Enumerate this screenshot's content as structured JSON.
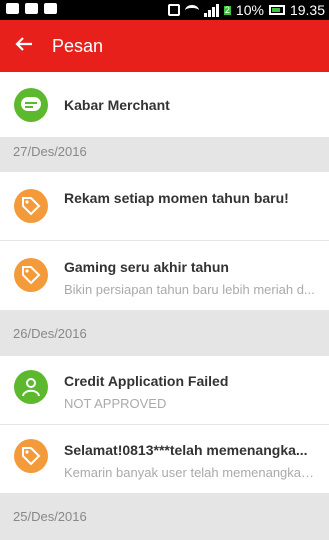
{
  "status_bar": {
    "battery": "10%",
    "time": "19.35",
    "sim_label": "2"
  },
  "app_bar": {
    "title": "Pesan"
  },
  "merchant": {
    "title": "Kabar Merchant"
  },
  "sections": [
    {
      "date": "27/Des/2016",
      "items": [
        {
          "title": "Rekam setiap momen tahun baru!",
          "subtitle": "",
          "icon": "tag-icon"
        },
        {
          "title": "Gaming seru akhir tahun",
          "subtitle": "Bikin persiapan tahun baru lebih meriah d...",
          "icon": "tag-icon"
        }
      ]
    },
    {
      "date": "26/Des/2016",
      "items": [
        {
          "title": "Credit Application Failed",
          "subtitle": "NOT APPROVED",
          "icon": "user-icon"
        },
        {
          "title": "Selamat!0813***telah memenangka...",
          "subtitle": "Kemarin banyak user telah memenangkan...",
          "icon": "tag-icon"
        }
      ]
    },
    {
      "date": "25/Des/2016",
      "items": []
    }
  ],
  "colors": {
    "accent": "#e8201b",
    "orange_icon": "#f39a3b",
    "green_icon": "#5cb82d"
  }
}
